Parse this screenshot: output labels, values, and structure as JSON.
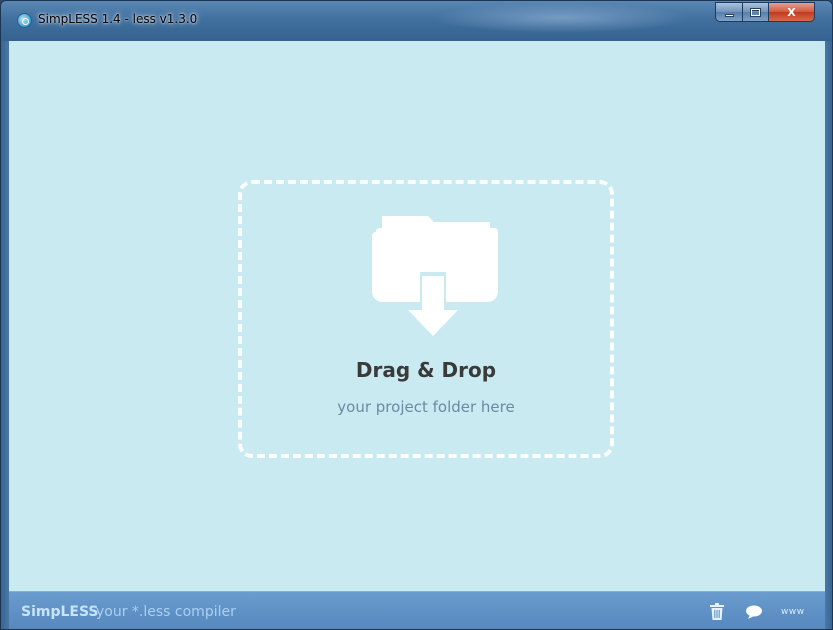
{
  "window": {
    "title": "SimpLESS 1.4 - less v1.3.0",
    "icon": "app-logo-icon",
    "controls": [
      "minimize-icon",
      "maximize-icon",
      "close-icon"
    ],
    "close_glyph": "X"
  },
  "dropzone": {
    "icon": "folder-download-icon",
    "title": "Drag & Drop",
    "subtitle": "your project folder here"
  },
  "statusbar": {
    "brand": "SimpLESS",
    "tagline": "your *.less compiler",
    "icons": [
      "trash-icon",
      "chat-icon"
    ],
    "www_label": "www"
  },
  "colors": {
    "background": "#c9eaf1",
    "statusbar": "#5687bd",
    "title_text": "#3a3a3a",
    "subtitle_text": "#6b8aa6"
  }
}
